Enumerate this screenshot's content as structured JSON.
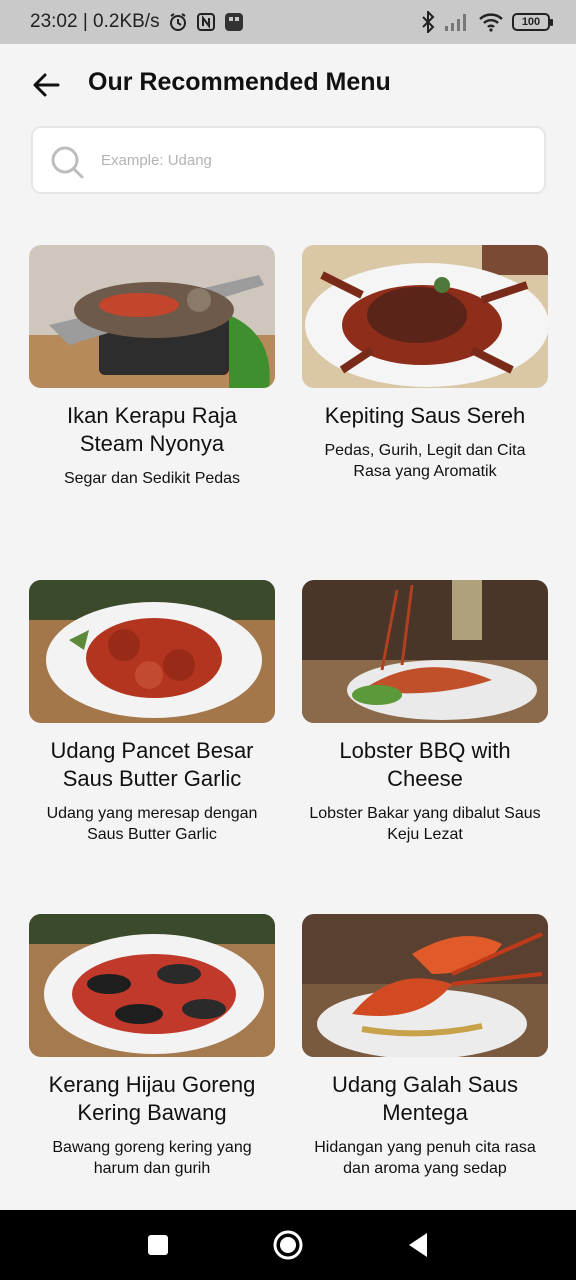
{
  "status_bar": {
    "time_speed": "23:02 | 0.2KB/s",
    "battery": "100"
  },
  "header": {
    "title": "Our Recommended Menu"
  },
  "search": {
    "placeholder": "Example: Udang",
    "value": ""
  },
  "menu": [
    {
      "name": "Ikan Kerapu Raja Steam Nyonya",
      "desc": "Segar dan Sedikit Pedas"
    },
    {
      "name": "Kepiting Saus Sereh",
      "desc": "Pedas, Gurih, Legit dan Cita Rasa yang Aromatik"
    },
    {
      "name": "Udang Pancet Besar Saus Butter Garlic",
      "desc": "Udang yang meresap dengan Saus Butter Garlic"
    },
    {
      "name": "Lobster BBQ with Cheese",
      "desc": "Lobster Bakar yang dibalut Saus Keju Lezat"
    },
    {
      "name": "Kerang Hijau Goreng Kering Bawang",
      "desc": "Bawang goreng kering yang harum dan gurih"
    },
    {
      "name": "Udang Galah Saus Mentega",
      "desc": "Hidangan yang penuh cita rasa dan aroma yang sedap"
    }
  ]
}
